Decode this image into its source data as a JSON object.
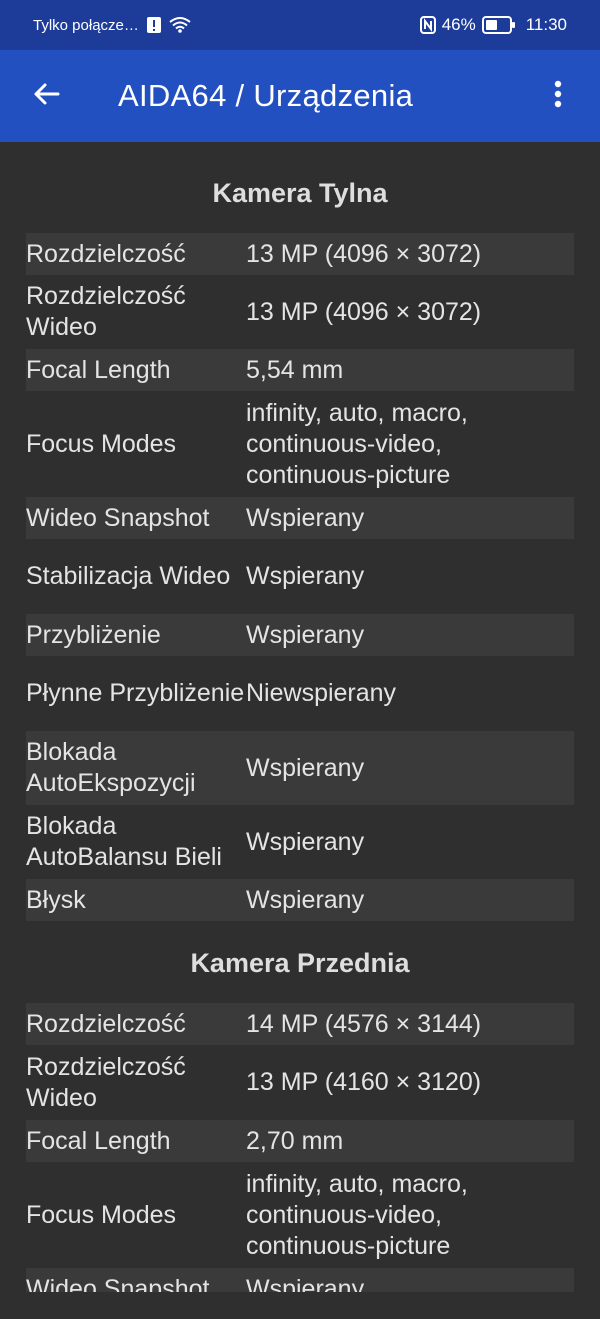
{
  "status_bar": {
    "network_label": "Tylko połącze…",
    "battery_percent": "46%",
    "time": "11:30"
  },
  "app_bar": {
    "title": "AIDA64  /  Urządzenia"
  },
  "rear_camera": {
    "title": "Kamera Tylna",
    "rows": [
      {
        "label": "Rozdzielczość",
        "value": "13 MP (4096 × 3072)"
      },
      {
        "label": "Rozdzielczość Wideo",
        "value": "13 MP (4096 × 3072)"
      },
      {
        "label": "Focal Length",
        "value": "5,54 mm"
      },
      {
        "label": "Focus Modes",
        "value": "infinity, auto, macro, continuous-video, continuous-picture"
      },
      {
        "label": "Wideo Snapshot",
        "value": "Wspierany"
      },
      {
        "label": "Stabilizacja Wideo",
        "value": "Wspierany"
      },
      {
        "label": "Przybliżenie",
        "value": "Wspierany"
      },
      {
        "label": "Płynne Przybliżenie",
        "value": "Niewspierany"
      },
      {
        "label": "Blokada AutoEkspozycji",
        "value": "Wspierany"
      },
      {
        "label": "Blokada AutoBalansu Bieli",
        "value": "Wspierany"
      },
      {
        "label": "Błysk",
        "value": "Wspierany"
      }
    ]
  },
  "front_camera": {
    "title": "Kamera Przednia",
    "rows": [
      {
        "label": "Rozdzielczość",
        "value": "14 MP (4576 × 3144)"
      },
      {
        "label": "Rozdzielczość Wideo",
        "value": "13 MP (4160 × 3120)"
      },
      {
        "label": "Focal Length",
        "value": "2,70 mm"
      },
      {
        "label": "Focus Modes",
        "value": "infinity, auto, macro, continuous-video, continuous-picture"
      },
      {
        "label": "Wideo Snapshot",
        "value": "Wspierany"
      }
    ]
  },
  "colors": {
    "status_bar_bg": "#1d3c9a",
    "app_bar_bg": "#2350c1",
    "page_bg": "#2f2f2f",
    "stripe_bg": "#3a3a3a"
  },
  "icons": {
    "back": "arrow-left-icon",
    "menu": "more-vert-icon",
    "alert": "alert-icon",
    "wifi": "wifi-icon",
    "nfc": "nfc-icon",
    "battery": "battery-icon"
  }
}
